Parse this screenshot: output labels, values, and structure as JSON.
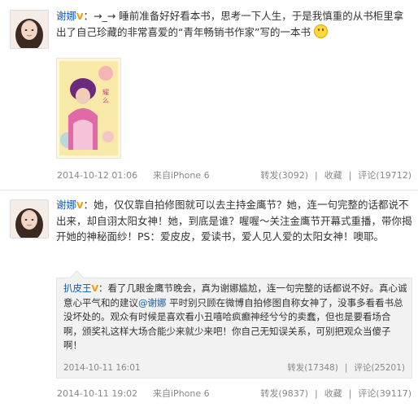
{
  "post1": {
    "user": "谢娜",
    "badge": "V",
    "sep": "：",
    "text": "→_→ 睡前准备好好看本书，思考一下人生，于是我慎重的从书柜里拿出了自己珍藏的非常喜爱的“青年畅销书作家”写的一本书",
    "book_image_icon": "book-cover-photo",
    "time": "2014-10-12 01:06",
    "source": "来自iPhone 6",
    "repost": "转发(3092)",
    "favorite": "收藏",
    "comment": "评论(19712)"
  },
  "post2": {
    "user": "谢娜",
    "badge": "V",
    "sep": "：",
    "text": "她，仅仅靠自拍修图就可以去主持金鹰节？她，连一句完整的话都说不出来，却自诩太阳女神！她，到底是谁？喔喔～关注金鹰节开幕式重播，带你揭开她的神秘面纱！PS：爱皮皮，爱读书，爱人见人爱的太阳女神！噢耶。",
    "quote": {
      "user": "扒皮王",
      "badge": "V",
      "sep": "：",
      "text_a": "看了几眼金鹰节晚会，真为谢娜尴尬，连一句完整的话都说不好。真心诚意心平气和的建议",
      "mention": "@谢娜",
      "text_b": " 平时别只顾在微博自拍修图自称女神了，没事多看看书总没坏处的。观众有时候是喜欢看小丑嘻哈疯癫神经兮兮的卖蠢，但也是要看场合啊，颁奖礼这样大场合能少来就少来吧！你自己无知误关系，可别把观众当傻子啊！",
      "time": "2014-10-11 16:01",
      "repost": "转发(17348)",
      "comment": "评论(25201)"
    },
    "time": "2014-10-11 19:02",
    "source": "来自iPhone 6",
    "repost": "转发(9837)",
    "favorite": "收藏",
    "comment": "评论(39117)"
  }
}
